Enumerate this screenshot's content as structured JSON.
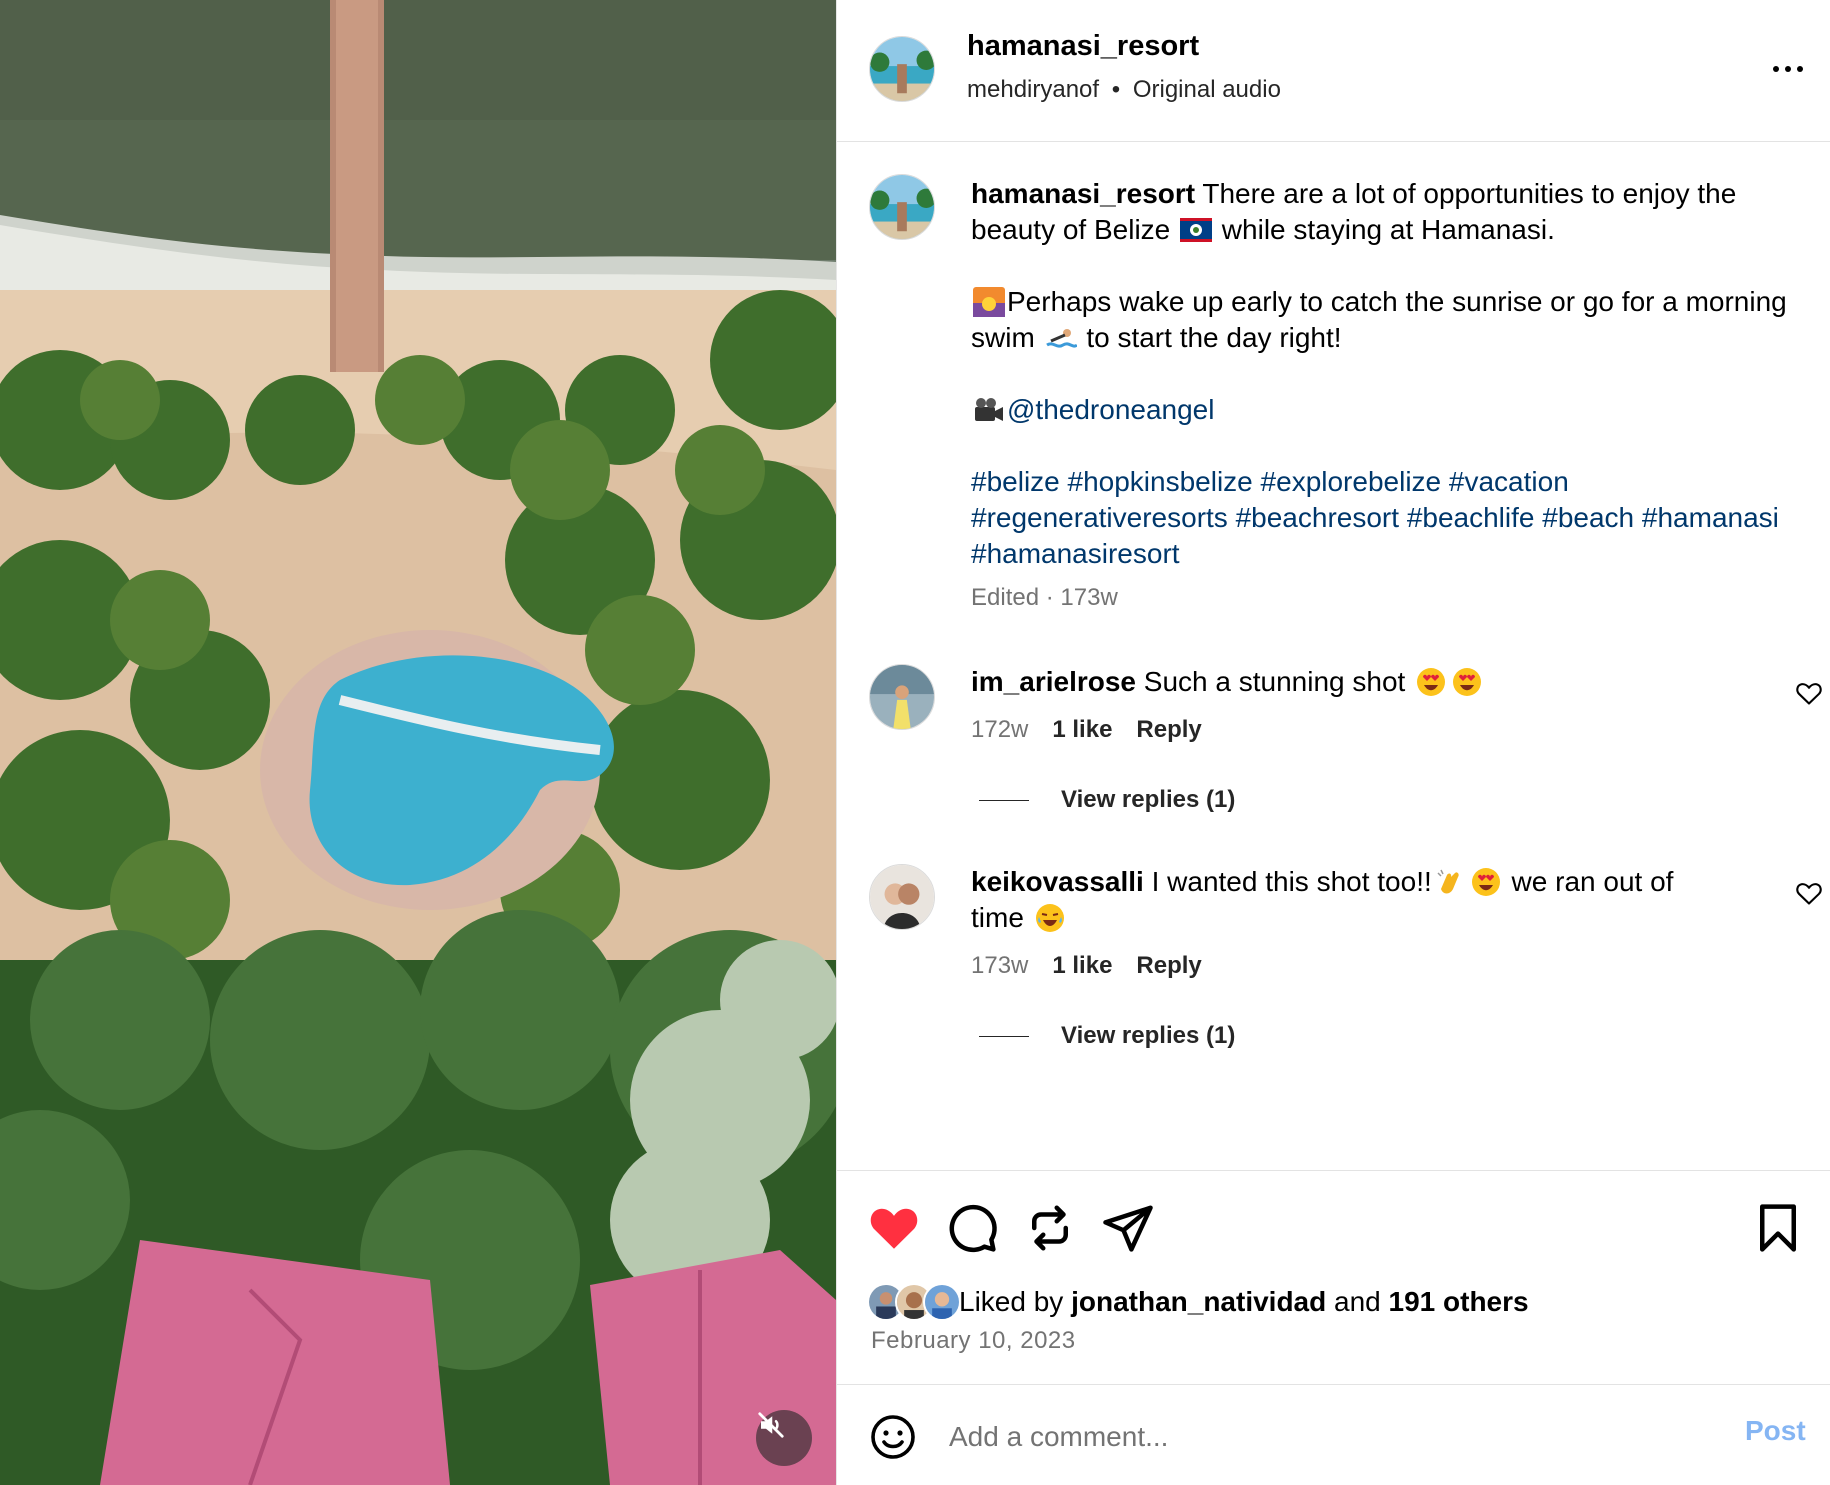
{
  "header": {
    "username": "hamanasi_resort",
    "audio_artist": "mehdiryanof",
    "separator": "•",
    "audio_label": "Original audio"
  },
  "caption": {
    "username": "hamanasi_resort",
    "line1_a": " There are a lot of opportunities to enjoy the beauty of Belize ",
    "line1_b": " while staying at Hamanasi.",
    "line2_a": "Perhaps wake up early to catch the sunrise or go for a morning swim ",
    "line2_b": " to start the day right!",
    "credit_handle": "@thedroneangel",
    "hashtags": [
      "#belize",
      "#hopkinsbelize",
      "#explorebelize",
      "#vacation",
      "#regenerativeresorts",
      "#beachresort",
      "#beachlife",
      "#beach",
      "#hamanasi",
      "#hamanasiresort"
    ],
    "edited": "Edited",
    "meta_sep": "·",
    "age": "173w"
  },
  "comments": [
    {
      "username": "im_arielrose",
      "text": " Such a stunning shot ",
      "age": "172w",
      "likes": "1 like",
      "reply_label": "Reply",
      "view_replies": "View replies (1)"
    },
    {
      "username": "keikovassalli",
      "text_a": " I wanted this shot too!!",
      "text_b": " we ran out of time ",
      "age": "173w",
      "likes": "1 like",
      "reply_label": "Reply",
      "view_replies": "View replies (1)"
    }
  ],
  "likes": {
    "prefix": "Liked by ",
    "user": "jonathan_natividad",
    "middle": " and ",
    "others": "191 others"
  },
  "post_date": "February 10, 2023",
  "add_comment": {
    "placeholder": "Add a comment...",
    "post_label": "Post"
  },
  "colors": {
    "like_red": "#ff3040",
    "link_blue": "#00376b",
    "post_button": "#85b5f3"
  }
}
